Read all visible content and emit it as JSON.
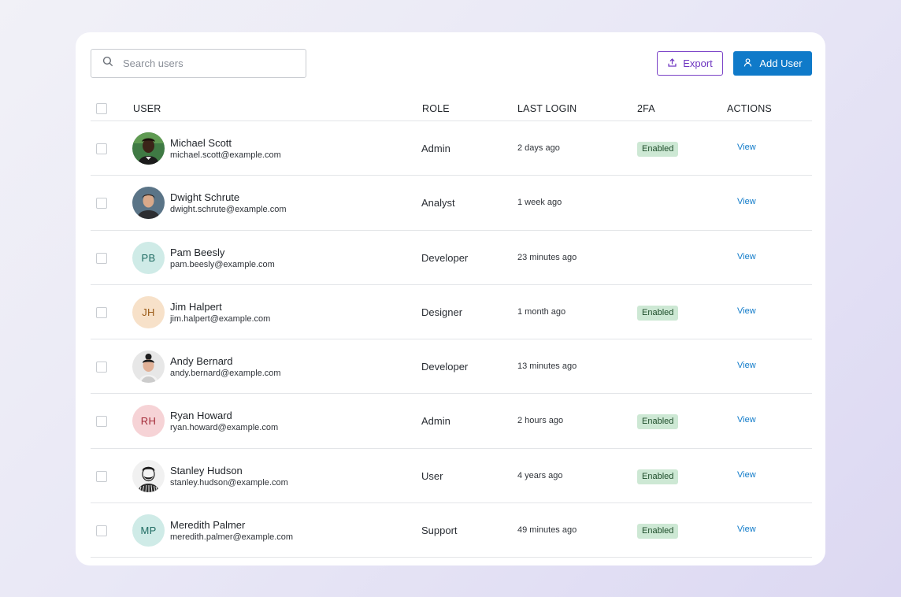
{
  "toolbar": {
    "search_placeholder": "Search users",
    "export_label": "Export",
    "add_label": "Add User"
  },
  "table": {
    "headers": {
      "user": "USER",
      "role": "ROLE",
      "last_login": "LAST LOGIN",
      "twofa": "2FA",
      "actions": "ACTIONS"
    },
    "rows": [
      {
        "name": "Michael Scott",
        "email": "michael.scott@example.com",
        "role": "Admin",
        "last_login": "2 days ago",
        "twofa": "Enabled",
        "action": "View",
        "avatar": "photo"
      },
      {
        "name": "Dwight Schrute",
        "email": "dwight.schrute@example.com",
        "role": "Analyst",
        "last_login": "1 week ago",
        "twofa": "",
        "action": "View",
        "avatar": "photo"
      },
      {
        "name": "Pam Beesly",
        "email": "pam.beesly@example.com",
        "role": "Developer",
        "last_login": "23 minutes ago",
        "twofa": "",
        "action": "View",
        "avatar": "initials",
        "initials": "PB"
      },
      {
        "name": "Jim Halpert",
        "email": "jim.halpert@example.com",
        "role": "Designer",
        "last_login": "1 month ago",
        "twofa": "Enabled",
        "action": "View",
        "avatar": "initials",
        "initials": "JH"
      },
      {
        "name": "Andy Bernard",
        "email": "andy.bernard@example.com",
        "role": "Developer",
        "last_login": "13 minutes ago",
        "twofa": "",
        "action": "View",
        "avatar": "photo"
      },
      {
        "name": "Ryan Howard",
        "email": "ryan.howard@example.com",
        "role": "Admin",
        "last_login": "2 hours ago",
        "twofa": "Enabled",
        "action": "View",
        "avatar": "initials",
        "initials": "RH"
      },
      {
        "name": "Stanley Hudson",
        "email": "stanley.hudson@example.com",
        "role": "User",
        "last_login": "4 years ago",
        "twofa": "Enabled",
        "action": "View",
        "avatar": "photo"
      },
      {
        "name": "Meredith Palmer",
        "email": "meredith.palmer@example.com",
        "role": "Support",
        "last_login": "49 minutes ago",
        "twofa": "Enabled",
        "action": "View",
        "avatar": "initials",
        "initials": "MP"
      }
    ]
  },
  "colors": {
    "primary": "#0f7ac9",
    "export_accent": "#6e35c0",
    "badge_bg": "#cde8d4",
    "badge_text": "#1f4e2b",
    "avatar_pb_bg": "#cfebe7",
    "avatar_pb_text": "#1f6b62",
    "avatar_jh_bg": "#f7e1c9",
    "avatar_jh_text": "#9a5a16",
    "avatar_rh_bg": "#f6d3d6",
    "avatar_rh_text": "#a32a37",
    "avatar_mp_bg": "#cfebe7",
    "avatar_mp_text": "#1f6b62"
  },
  "icons": {
    "search": "search-icon",
    "export": "upload-icon",
    "add": "user-icon"
  }
}
